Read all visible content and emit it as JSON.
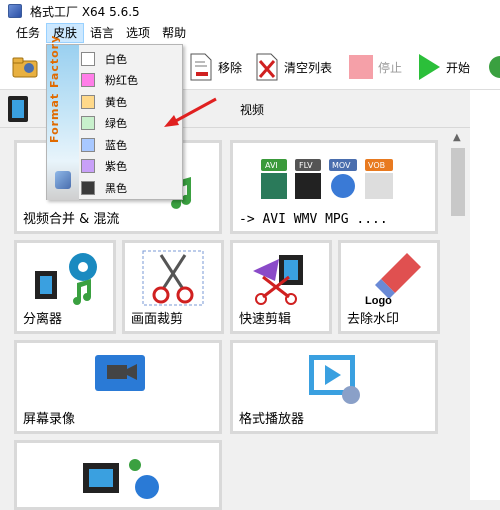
{
  "window": {
    "title": "格式工厂 X64 5.6.5"
  },
  "menu": {
    "items": [
      "任务",
      "皮肤",
      "语言",
      "选项",
      "帮助"
    ]
  },
  "toolbar": {
    "remove_label": "移除",
    "clear_list_label": "清空列表",
    "stop_label": "停止",
    "start_label": "开始"
  },
  "subheader": {
    "label": "视频"
  },
  "skin_menu": {
    "brand": "Format Factory",
    "items": [
      {
        "label": "白色",
        "color": "#ffffff"
      },
      {
        "label": "粉红色",
        "color": "#ff7de8"
      },
      {
        "label": "黄色",
        "color": "#ffd98a"
      },
      {
        "label": "绿色",
        "color": "#c8f0cc"
      },
      {
        "label": "蓝色",
        "color": "#a8c8ff"
      },
      {
        "label": "紫色",
        "color": "#c8a0f8"
      },
      {
        "label": "黑色",
        "color": "#3a3a3a"
      }
    ]
  },
  "tiles": {
    "merge": "视频合并 & 混流",
    "convert": "-> AVI WMV MPG ....",
    "separate": "分离器",
    "crop": "画面裁剪",
    "quick_cut": "快速剪辑",
    "watermark": "去除水印",
    "screen_record": "屏幕录像",
    "player": "格式播放器"
  },
  "format_badges": [
    "AVI",
    "FLV",
    "MOV",
    "VOB"
  ],
  "logo_text": "Logo",
  "colors": {
    "accent_red": "#e02020",
    "start_green": "#2bbf3a",
    "stop_pink": "#f5a0a8"
  }
}
